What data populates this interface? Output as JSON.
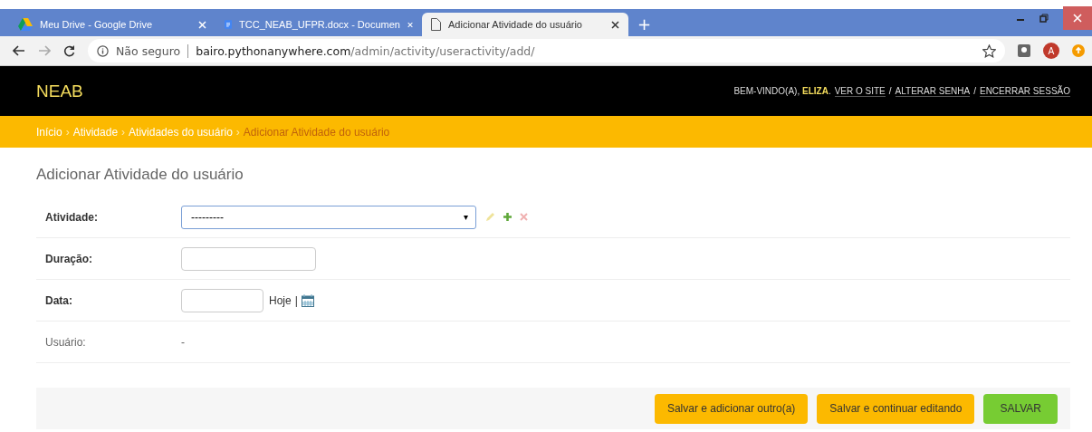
{
  "browser": {
    "tabs": [
      {
        "title": "Meu Drive - Google Drive",
        "kind": "drive",
        "selected": false
      },
      {
        "title": "TCC_NEAB_UFPR.docx - Documen",
        "kind": "doc",
        "selected": false
      },
      {
        "title": "Adicionar Atividade do usuário",
        "kind": "page",
        "selected": true
      }
    ],
    "new_tab": "+",
    "security": "Não seguro",
    "url_host": "bairo.pythonanywhere.com",
    "url_path": "/admin/activity/useractivity/add/",
    "profile_initial": "A"
  },
  "header": {
    "brand": "NEAB",
    "welcome": "BEM-VINDO(A), **ELIZA**.",
    "link_separator": "/",
    "links": [
      "VER O SITE",
      "ALTERAR SENHA",
      "ENCERRAR SESSÃO"
    ]
  },
  "breadcrumb_separator": "›",
  "breadcrumbs": [
    {
      "label": "Início",
      "current": false
    },
    {
      "label": "Atividade",
      "current": false
    },
    {
      "label": "Atividades do usuário",
      "current": false
    },
    {
      "label": "Adicionar Atividade do usuário",
      "current": true
    }
  ],
  "title": "Adicionar Atividade do usuário",
  "fields": [
    {
      "label": "Atividade:",
      "kind": "select",
      "value": "---------",
      "caret": "▾",
      "required": true
    },
    {
      "label": "Duração:",
      "kind": "text",
      "required": true
    },
    {
      "label": "Data:",
      "kind": "date",
      "required": true,
      "today": "Hoje",
      "separator": "|"
    },
    {
      "label": "Usuário:",
      "kind": "readonly",
      "value": "-",
      "required": false
    }
  ],
  "buttons": [
    {
      "label": "Salvar e adicionar outro(a)",
      "kind": "secondary"
    },
    {
      "label": "Salvar e continuar editando",
      "kind": "secondary"
    },
    {
      "label": "SALVAR",
      "kind": "primary"
    }
  ]
}
